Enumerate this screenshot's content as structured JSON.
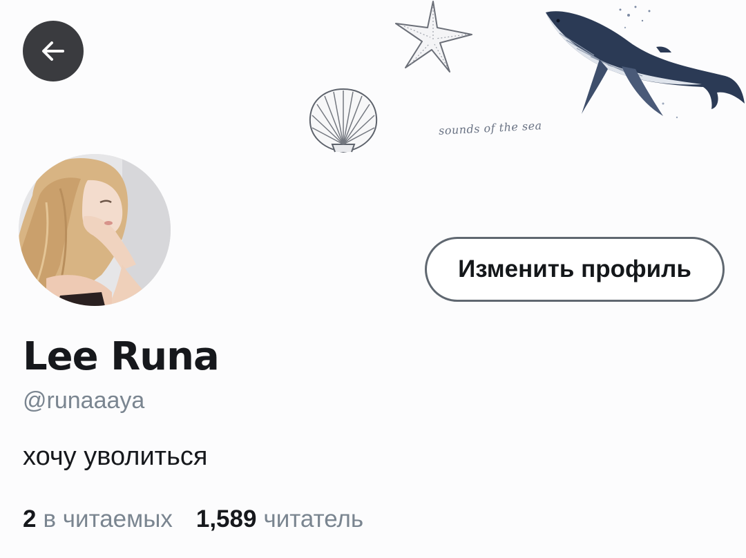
{
  "banner": {
    "caption": "sounds of the sea"
  },
  "header": {
    "back_icon": "arrow-left-icon"
  },
  "profile": {
    "edit_button_label": "Изменить профиль",
    "display_name": "Lee Runa",
    "handle": "@runaaaya",
    "bio": "хочу уволиться",
    "following_count": "2",
    "following_label": "в читаемых",
    "followers_count": "1,589",
    "followers_label": "читатель"
  },
  "colors": {
    "back_button_bg": "#3a3b3f",
    "whale_dark": "#2b3a55",
    "secondary_text": "#7a8590",
    "button_border": "#5f6770"
  }
}
